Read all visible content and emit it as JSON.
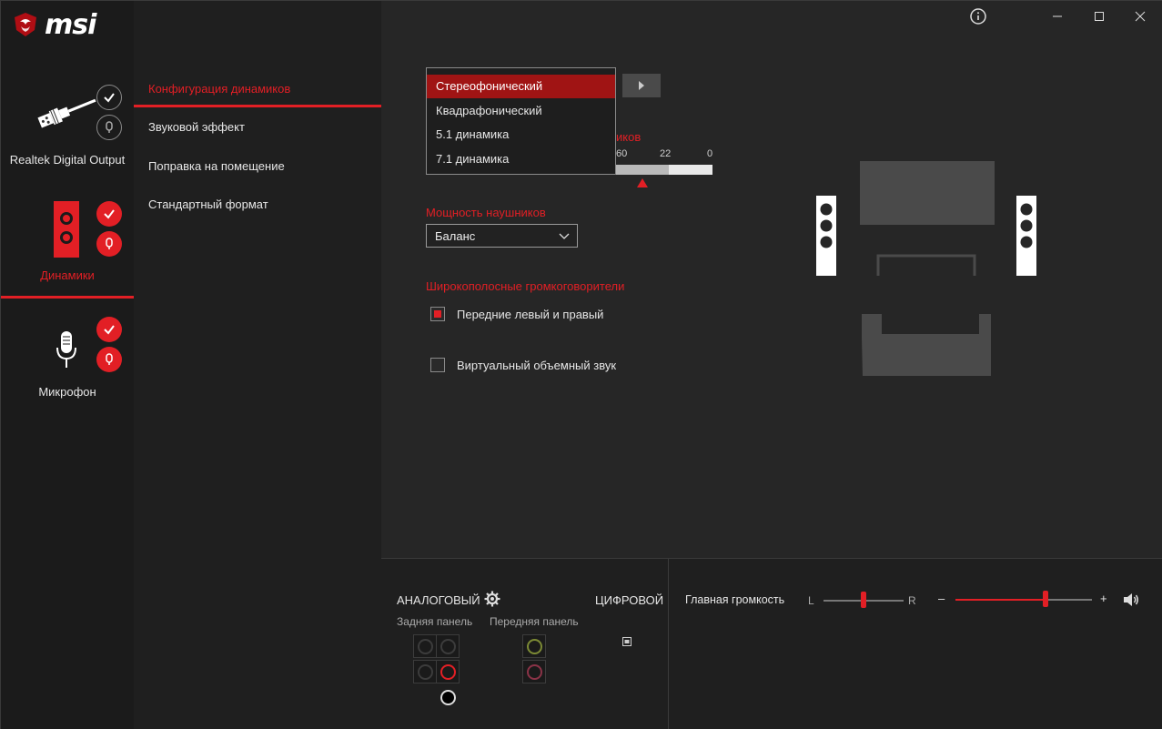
{
  "brand": {
    "name": "msi",
    "accent": "#e21f25"
  },
  "devices": [
    {
      "label": "Realtek Digital Output",
      "icon": "digital-plug-icon",
      "active": false
    },
    {
      "label": "Динамики",
      "icon": "speaker-icon",
      "active": true
    },
    {
      "label": "Микрофон",
      "icon": "microphone-icon",
      "active": false
    }
  ],
  "menu": {
    "items": [
      {
        "label": "Конфигурация динамиков",
        "active": true
      },
      {
        "label": "Звуковой эффект",
        "active": false
      },
      {
        "label": "Поправка на помещение",
        "active": false
      },
      {
        "label": "Стандартный формат",
        "active": false
      }
    ]
  },
  "speaker_config": {
    "options": [
      "Стереофонический",
      "Квадрафонический",
      "5.1 динамика",
      "7.1 динамика"
    ],
    "selected": "Стереофонический",
    "hidden_title_fragment": "иков",
    "meter_labels": [
      "60",
      "22",
      "0"
    ],
    "meter_fill_fraction": 0.55
  },
  "headphones": {
    "title": "Мощность наушников",
    "value": "Баланс"
  },
  "fullrange": {
    "title": "Широкополосные громкоговорители",
    "front_label": "Передние левый и правый",
    "front_checked": true,
    "virtual_label": "Виртуальный объемный звук",
    "virtual_checked": false
  },
  "bottom": {
    "analog_label": "АНАЛОГОВЫЙ",
    "digital_label": "ЦИФРОВОЙ",
    "rear_panel": "Задняя панель",
    "front_panel": "Передняя панель",
    "master_volume": "Главная громкость",
    "balance_left": "L",
    "balance_right": "R",
    "vol_minus": "–",
    "vol_plus": "+",
    "balance_value": 0.5,
    "volume_value": 0.66
  }
}
